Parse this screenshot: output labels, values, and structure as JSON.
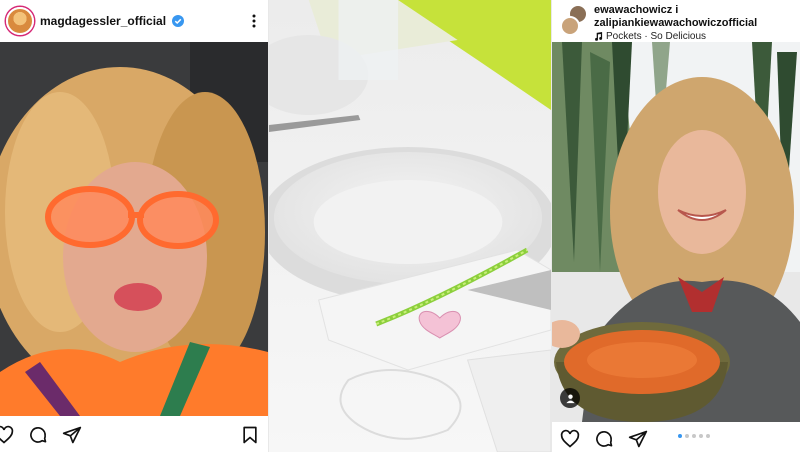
{
  "left_post": {
    "username": "magdagessler_official",
    "verified_icon": "verified-badge-icon",
    "more_icon": "more-options-icon",
    "actions": [
      "like-icon",
      "comment-icon",
      "share-icon",
      "save-icon"
    ]
  },
  "middle_image": {
    "description_icon": "table-setting-photo"
  },
  "right_post": {
    "username_line1": "ewawachowicz i",
    "username_line2": "zalipiankiewawachowiczofficial",
    "music": "Pockets · So Delicious",
    "music_icon": "music-note-icon",
    "actions": [
      "like-icon",
      "comment-icon",
      "share-icon"
    ],
    "carousel": {
      "total": 5,
      "active_index": 0
    }
  },
  "colors": {
    "accent_blue": "#3897f0",
    "ring": "#d62976",
    "soup": "#e06a2a",
    "lime": "#c6e23a"
  }
}
